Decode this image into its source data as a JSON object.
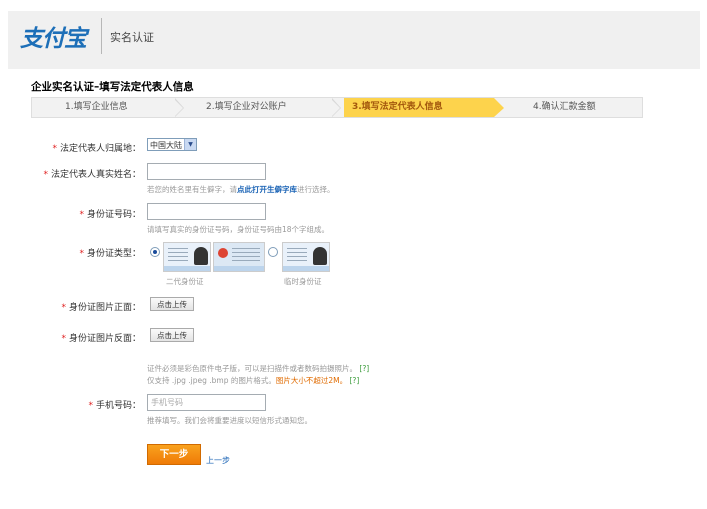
{
  "header": {
    "logo_main": "支付宝",
    "title": "实名认证"
  },
  "page_title": "企业实名认证–填写法定代表人信息",
  "steps": [
    {
      "label": "1.填写企业信息",
      "active": false
    },
    {
      "label": "2.填写企业对公账户",
      "active": false
    },
    {
      "label": "3.填写法定代表人信息",
      "active": true
    },
    {
      "label": "4.确认汇款金额",
      "active": false
    }
  ],
  "form": {
    "region": {
      "star": "*",
      "label": "法定代表人归属地：",
      "value": "中国大陆",
      "arrow": "▼"
    },
    "name": {
      "star": "*",
      "label": "法定代表人真实姓名：",
      "value": "",
      "hint_pre": "若您的姓名里有生僻字，请",
      "hint_link": "点此打开生僻字库",
      "hint_post": "进行选择。"
    },
    "id_number": {
      "star": "*",
      "label": "身份证号码：",
      "value": "",
      "hint": "请填写真实的身份证号码，身份证号码由18个字组成。"
    },
    "id_type": {
      "star": "*",
      "label": "身份证类型：",
      "option1": "二代身份证",
      "option2": "临时身份证",
      "selected": "option1"
    },
    "front": {
      "star": "*",
      "label": "身份证图片正面：",
      "button": "点击上传"
    },
    "back": {
      "star": "*",
      "label": "身份证图片反面：",
      "button": "点击上传"
    },
    "upload_hint_1": "证件必须是彩色原件电子版，可以是扫描件或者数码拍摄照片。",
    "upload_hint_2_pre": "仅支持 .jpg .jpeg .bmp 的图片格式。",
    "upload_hint_2_orange": "图片大小不超过2M。",
    "help_mark": "[?]",
    "phone": {
      "star": "*",
      "label": "手机号码：",
      "placeholder": "手机号码",
      "hint": "推荐填写。我们会将重要进度以短信形式通知您。"
    }
  },
  "actions": {
    "next": "下一步",
    "prev": "上一步"
  }
}
